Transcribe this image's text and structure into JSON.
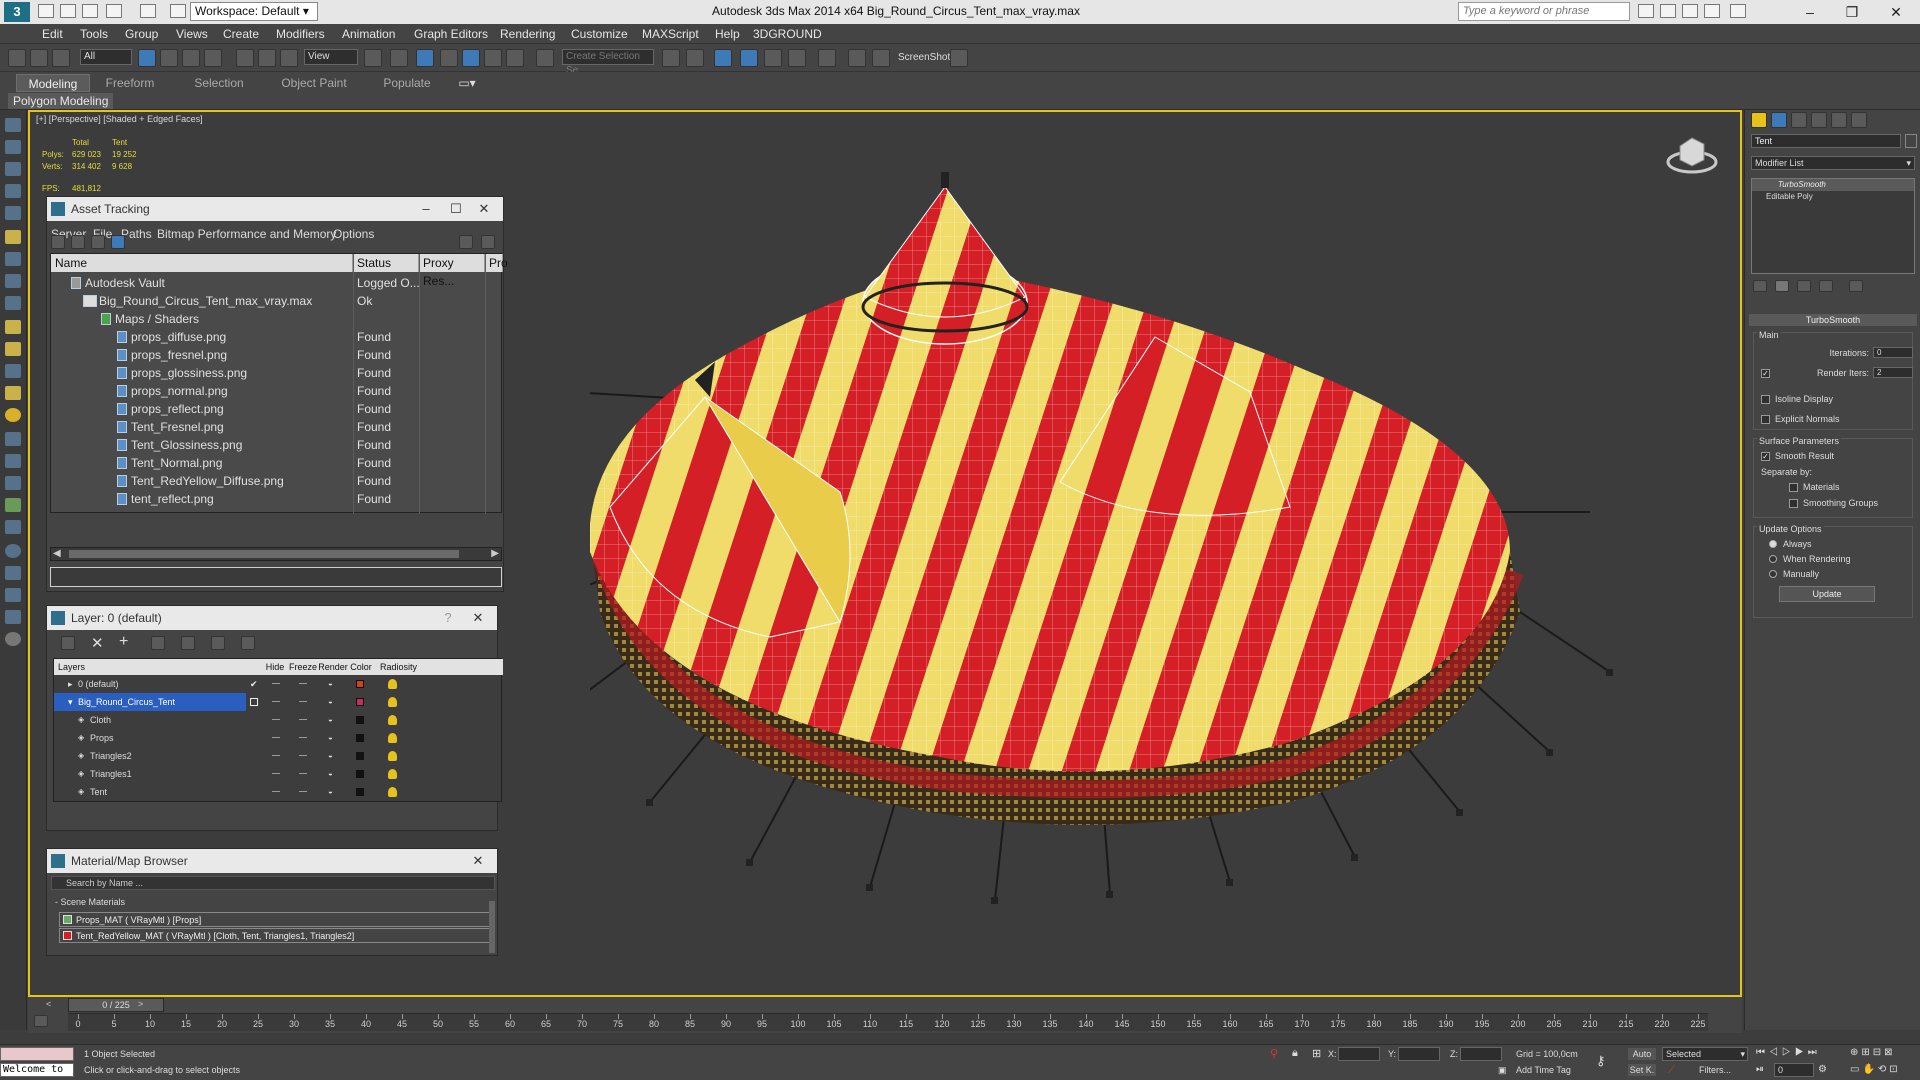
{
  "app": {
    "workspace_label": "Workspace: Default",
    "title": "Autodesk 3ds Max  2014 x64     Big_Round_Circus_Tent_max_vray.max",
    "search_placeholder": "Type a keyword or phrase"
  },
  "menu": [
    "Edit",
    "Tools",
    "Group",
    "Views",
    "Create",
    "Modifiers",
    "Animation",
    "Graph Editors",
    "Rendering",
    "Customize",
    "MAXScript",
    "Help",
    "3DGROUND"
  ],
  "toolbar": {
    "filter_select": "All",
    "refcoord_select": "View",
    "named_selection": "Create Selection Se",
    "screenshot_label": "ScreenShot"
  },
  "ribbon": {
    "tabs": [
      "Modeling",
      "Freeform",
      "Selection",
      "Object Paint",
      "Populate"
    ],
    "active_tab": "Modeling",
    "panel_label": "Polygon Modeling"
  },
  "viewport": {
    "label": "[+] [Perspective] [Shaded + Edged Faces]",
    "stats": {
      "col_total": "Total",
      "col_tent": "Tent",
      "polys_label": "Polys:",
      "polys_total": "629 023",
      "polys_tent": "19 252",
      "verts_label": "Verts:",
      "verts_total": "314 402",
      "verts_tent": "9 628",
      "fps_label": "FPS:",
      "fps_value": "481,812"
    }
  },
  "asset_tracking": {
    "title": "Asset Tracking",
    "menu": [
      "Server",
      "File",
      "Paths",
      "Bitmap Performance and Memory",
      "Options"
    ],
    "columns": [
      "Name",
      "Status",
      "Proxy Res...",
      "Pro"
    ],
    "rows": [
      {
        "name": "Autodesk Vault",
        "status": "Logged O..."
      },
      {
        "name": "Big_Round_Circus_Tent_max_vray.max",
        "status": "Ok"
      },
      {
        "name": "Maps / Shaders",
        "status": ""
      },
      {
        "name": "props_diffuse.png",
        "status": "Found"
      },
      {
        "name": "props_fresnel.png",
        "status": "Found"
      },
      {
        "name": "props_glossiness.png",
        "status": "Found"
      },
      {
        "name": "props_normal.png",
        "status": "Found"
      },
      {
        "name": "props_reflect.png",
        "status": "Found"
      },
      {
        "name": "Tent_Fresnel.png",
        "status": "Found"
      },
      {
        "name": "Tent_Glossiness.png",
        "status": "Found"
      },
      {
        "name": "Tent_Normal.png",
        "status": "Found"
      },
      {
        "name": "Tent_RedYellow_Diffuse.png",
        "status": "Found"
      },
      {
        "name": "tent_reflect.png",
        "status": "Found"
      }
    ]
  },
  "layer_panel": {
    "title": "Layer: 0 (default)",
    "help": "?",
    "columns": [
      "Layers",
      "Hide",
      "Freeze",
      "Render",
      "Color",
      "Radiosity"
    ],
    "rows": [
      {
        "name": "0 (default)",
        "color": "#d04020"
      },
      {
        "name": "Big_Round_Circus_Tent",
        "color": "#c0305a"
      },
      {
        "name": "Cloth",
        "color": "#111111"
      },
      {
        "name": "Props",
        "color": "#111111"
      },
      {
        "name": "Triangles2",
        "color": "#111111"
      },
      {
        "name": "Triangles1",
        "color": "#111111"
      },
      {
        "name": "Tent",
        "color": "#111111"
      }
    ]
  },
  "material_browser": {
    "title": "Material/Map Browser",
    "search_placeholder": "Search by Name ...",
    "group": "- Scene Materials",
    "items": [
      "Props_MAT  ( VRayMtl )  [Props]",
      "Tent_RedYellow_MAT  ( VRayMtl )  [Cloth, Tent, Triangles1, Triangles2]"
    ]
  },
  "command_panel": {
    "object_name": "Tent",
    "modifier_list": "Modifier List",
    "stack": [
      "TurboSmooth",
      "Editable Poly"
    ],
    "rollout_title": "TurboSmooth",
    "main_label": "Main",
    "iterations_label": "Iterations:",
    "iterations_value": "0",
    "render_iters_label": "Render Iters:",
    "render_iters_value": "2",
    "isoline_label": "Isoline Display",
    "explicit_normals_label": "Explicit Normals",
    "surface_params_label": "Surface Parameters",
    "smooth_result_label": "Smooth Result",
    "separate_by_label": "Separate by:",
    "materials_label": "Materials",
    "smoothing_groups_label": "Smoothing Groups",
    "update_options_label": "Update Options",
    "always_label": "Always",
    "when_rendering_label": "When Rendering",
    "manually_label": "Manually",
    "update_button": "Update"
  },
  "timeline": {
    "slider": "0 / 225",
    "ticks": [
      0,
      5,
      10,
      15,
      20,
      25,
      30,
      35,
      40,
      45,
      50,
      55,
      60,
      65,
      70,
      75,
      80,
      85,
      90,
      95,
      100,
      105,
      110,
      115,
      120,
      125,
      130,
      135,
      140,
      145,
      150,
      155,
      160,
      165,
      170,
      175,
      180,
      185,
      190,
      195,
      200,
      205,
      210,
      215,
      220,
      225
    ]
  },
  "status": {
    "maxscript": "Welcome to",
    "selected": "1 Object Selected",
    "prompt": "Click or click-and-drag to select objects",
    "x_label": "X:",
    "y_label": "Y:",
    "z_label": "Z:",
    "grid": "Grid = 100,0cm",
    "add_time_tag": "Add Time Tag",
    "auto": "Auto",
    "set_key": "Set K.",
    "key_filter": "Selected",
    "filters": "Filters...",
    "frame": "0"
  },
  "colors": {
    "accent_yellow": "#e6c21a",
    "tent_red": "#d51f26",
    "tent_yellow": "#f0dc6a",
    "selection_blue": "#2a5fbf"
  }
}
